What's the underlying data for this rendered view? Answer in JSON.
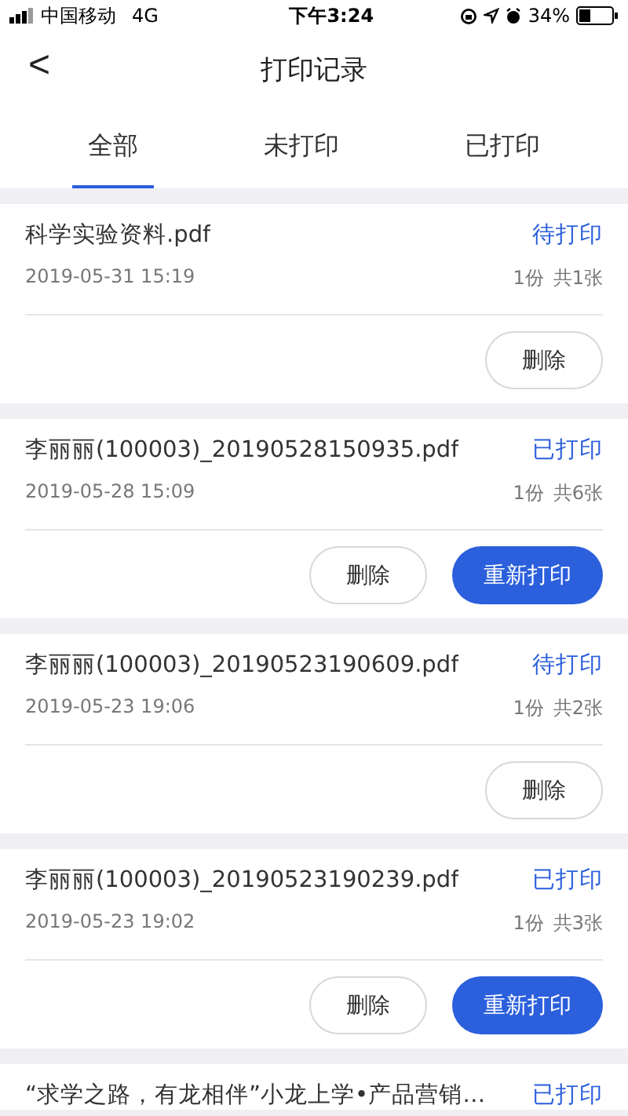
{
  "status_bar": {
    "carrier": "中国移动",
    "network": "4G",
    "time": "下午3:24",
    "battery": "34%"
  },
  "nav": {
    "back": "<",
    "title": "打印记录"
  },
  "tabs": [
    {
      "label": "全部",
      "selected": true
    },
    {
      "label": "未打印",
      "selected": false
    },
    {
      "label": "已打印",
      "selected": false
    }
  ],
  "records": [
    {
      "name": "科学实验资料.pdf",
      "status": "待打印",
      "time": "2019-05-31 15:19",
      "copies": "1份",
      "pages": "共1张",
      "buttons": [
        {
          "label": "删除",
          "kind": "outline"
        }
      ]
    },
    {
      "name": "李丽丽(100003)_20190528150935.pdf",
      "status": "已打印",
      "time": "2019-05-28 15:09",
      "copies": "1份",
      "pages": "共6张",
      "buttons": [
        {
          "label": "删除",
          "kind": "outline"
        },
        {
          "label": "重新打印",
          "kind": "primary"
        }
      ]
    },
    {
      "name": "李丽丽(100003)_20190523190609.pdf",
      "status": "待打印",
      "time": "2019-05-23 19:06",
      "copies": "1份",
      "pages": "共2张",
      "buttons": [
        {
          "label": "删除",
          "kind": "outline"
        }
      ]
    },
    {
      "name": "李丽丽(100003)_20190523190239.pdf",
      "status": "已打印",
      "time": "2019-05-23 19:02",
      "copies": "1份",
      "pages": "共3张",
      "buttons": [
        {
          "label": "删除",
          "kind": "outline"
        },
        {
          "label": "重新打印",
          "kind": "primary"
        }
      ]
    },
    {
      "name": "“求学之路，有龙相伴”小龙上学•产品营销…",
      "status": "已打印"
    }
  ]
}
